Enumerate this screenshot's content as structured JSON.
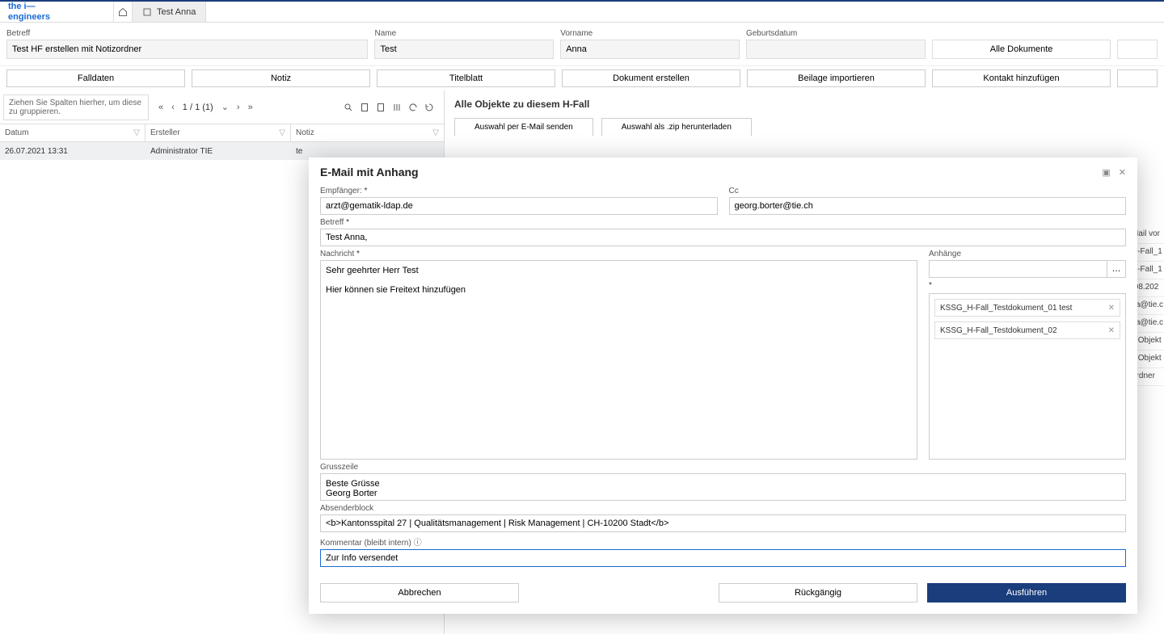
{
  "logo": "the i— engineers",
  "tab_name": "Test Anna",
  "header_fields": {
    "betreff": {
      "label": "Betreff",
      "value": "Test HF erstellen mit Notizordner"
    },
    "name": {
      "label": "Name",
      "value": "Test"
    },
    "vorname": {
      "label": "Vorname",
      "value": "Anna"
    },
    "geburtsdatum": {
      "label": "Geburtsdatum",
      "value": ""
    },
    "alle_dokumente": "Alle Dokumente"
  },
  "actions": {
    "fall": "Falldaten",
    "notiz": "Notiz",
    "titel": "Titelblatt",
    "dok": "Dokument erstellen",
    "beilage": "Beilage importieren",
    "kontakt": "Kontakt hinzufügen"
  },
  "grid": {
    "group_hint": "Ziehen Sie Spalten hierher, um diese zu gruppieren.",
    "page": "1 / 1 (1)",
    "cols": {
      "datum": "Datum",
      "ersteller": "Ersteller",
      "notiz": "Notiz"
    },
    "row": {
      "datum": "26.07.2021 13:31",
      "ersteller": "Administrator TIE",
      "notiz": "te"
    }
  },
  "right": {
    "title": "Alle Objekte zu diesem H-Fall",
    "send_mail": "Auswahl per E-Mail senden",
    "dl_zip": "Auswahl als .zip herunterladen"
  },
  "side_items": [
    "Mail vor",
    "H-Fall_1",
    "H-Fall_1",
    ".08.202",
    "za@tie.c",
    "za@tie.c",
    "s Objekt",
    "s Objekt",
    "ordner"
  ],
  "modal": {
    "title": "E-Mail mit Anhang",
    "empf": {
      "label": "Empfänger:",
      "value": "arzt@gematik-ldap.de"
    },
    "cc": {
      "label": "Cc",
      "value": "georg.borter@tie.ch"
    },
    "betreff": {
      "label": "Betreff",
      "value": "Test Anna,"
    },
    "nachricht": {
      "label": "Nachricht",
      "value": "Sehr geehrter Herr Test\n\nHier können sie Freitext hinzufügen"
    },
    "anhaenge": {
      "label": "Anhänge",
      "items": [
        "KSSG_H-Fall_Testdokument_01 test",
        "KSSG_H-Fall_Testdokument_02"
      ]
    },
    "gruss": {
      "label": "Grusszeile",
      "value": "Beste Grüsse\nGeorg Borter"
    },
    "absender": {
      "label": "Absenderblock",
      "value": "<b>Kantonsspital 27 | Qualitätsmanagement | Risk Management | CH-10200 Stadt</b>"
    },
    "kommentar": {
      "label": "Kommentar (bleibt intern)",
      "value": "Zur Info versendet"
    },
    "buttons": {
      "cancel": "Abbrechen",
      "undo": "Rückgängig",
      "exec": "Ausführen"
    }
  }
}
